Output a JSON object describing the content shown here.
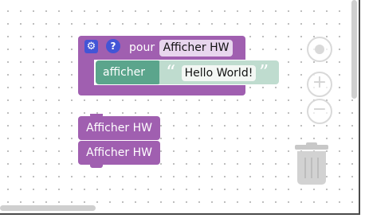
{
  "definition_block": {
    "keyword": "pour",
    "name": "Afficher HW",
    "gear_icon": "gear-icon",
    "help_icon": "?"
  },
  "print_block": {
    "label": "afficher",
    "open_quote": "“",
    "value": "Hello World!",
    "close_quote": "”"
  },
  "call_blocks": [
    {
      "label": "Afficher HW"
    },
    {
      "label": "Afficher HW"
    }
  ],
  "controls": {
    "zoom_in": "+",
    "zoom_out": "−"
  },
  "colors": {
    "procedure": "#a05fb0",
    "print": "#5ba58c",
    "string": "#bfdccf",
    "button": "#4355d6"
  }
}
